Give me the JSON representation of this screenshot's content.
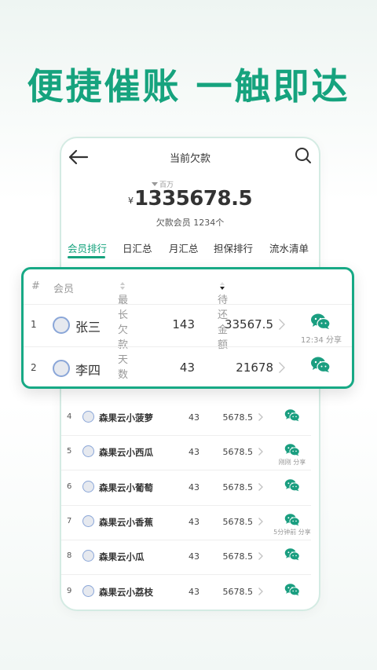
{
  "headline": "便捷催账 一触即达",
  "nav": {
    "title": "当前欠款",
    "back_icon": "back-arrow-icon",
    "search_icon": "search-icon"
  },
  "summary": {
    "unit": "百万",
    "currency": "¥",
    "amount": "1335678.5",
    "members": "欠款会员 1234个"
  },
  "tabs": [
    "会员排行",
    "日汇总",
    "月汇总",
    "担保排行",
    "流水清单"
  ],
  "active_tab": 0,
  "table": {
    "headers": {
      "rank": "#",
      "member": "会员",
      "days": "最长欠款天数",
      "amount": "待还金额"
    },
    "featured_rows": [
      {
        "rank": "1",
        "name": "张三",
        "days": "143",
        "amount": "33567.5",
        "share": "12:34 分享"
      },
      {
        "rank": "2",
        "name": "李四",
        "days": "43",
        "amount": "21678",
        "share": ""
      }
    ],
    "rows": [
      {
        "rank": "4",
        "name": "森果云小菠萝",
        "days": "43",
        "amount": "5678.5",
        "share": ""
      },
      {
        "rank": "5",
        "name": "森果云小西瓜",
        "days": "43",
        "amount": "5678.5",
        "share": "刚刚 分享"
      },
      {
        "rank": "6",
        "name": "森果云小葡萄",
        "days": "43",
        "amount": "5678.5",
        "share": ""
      },
      {
        "rank": "7",
        "name": "森果云小香蕉",
        "days": "43",
        "amount": "5678.5",
        "share": "5分钟前 分享"
      },
      {
        "rank": "8",
        "name": "森果云小瓜",
        "days": "43",
        "amount": "5678.5",
        "share": ""
      },
      {
        "rank": "9",
        "name": "森果云小荔枝",
        "days": "43",
        "amount": "5678.5",
        "share": ""
      }
    ]
  },
  "colors": {
    "accent": "#16a37e",
    "wechat": "#1a9e80",
    "avatar_border": "#8aa6d8"
  },
  "icons": {
    "chevron": "chevron-right-icon",
    "wechat": "wechat-icon",
    "avatar": "avatar"
  }
}
